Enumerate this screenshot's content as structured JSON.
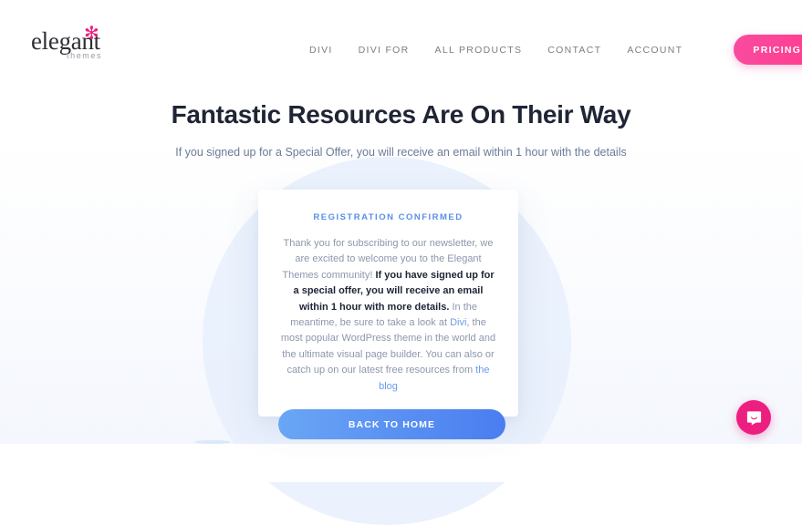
{
  "header": {
    "logo": {
      "name": "elegant",
      "star": "✻",
      "sub": "themes"
    },
    "nav": [
      {
        "label": "DIVI",
        "name": "nav-link-divi"
      },
      {
        "label": "DIVI FOR",
        "name": "nav-link-divi-for"
      },
      {
        "label": "ALL PRODUCTS",
        "name": "nav-link-all-products"
      },
      {
        "label": "CONTACT",
        "name": "nav-link-contact"
      },
      {
        "label": "ACCOUNT",
        "name": "nav-link-account"
      }
    ],
    "pricing_label": "PRICING",
    "pricing_gradient_from": "#f94ba0",
    "pricing_gradient_to": "#ff3d8f"
  },
  "hero": {
    "title": "Fantastic Resources Are On Their Way",
    "subtitle": "If you signed up for a Special Offer, you will receive an email within 1 hour with the details"
  },
  "card": {
    "eyebrow": "REGISTRATION CONFIRMED",
    "eyebrow_color": "#5a8fe8",
    "body": {
      "part1": "Thank you for subscribing to our newsletter, we are excited to welcome you to the Elegant Themes community! ",
      "bold": "If you have signed up for a special offer, you will receive an email within 1 hour with more details.",
      "part2": " In the meantime, be sure to take a look at ",
      "link1": "Divi",
      "part3": ", the most popular WordPress theme in the world and the ultimate visual page builder. You can also or catch up on our latest free resources from ",
      "link2": "the blog",
      "link_color": "#6a9bea"
    },
    "button_label": "BACK TO HOME",
    "button_gradient_from": "#6aa6f5",
    "button_gradient_to": "#4a7df0"
  },
  "chat": {
    "icon": "chat-bubble-icon",
    "color": "#ec1f80"
  },
  "decoration": {
    "circle_color": "#e8f0fd"
  }
}
